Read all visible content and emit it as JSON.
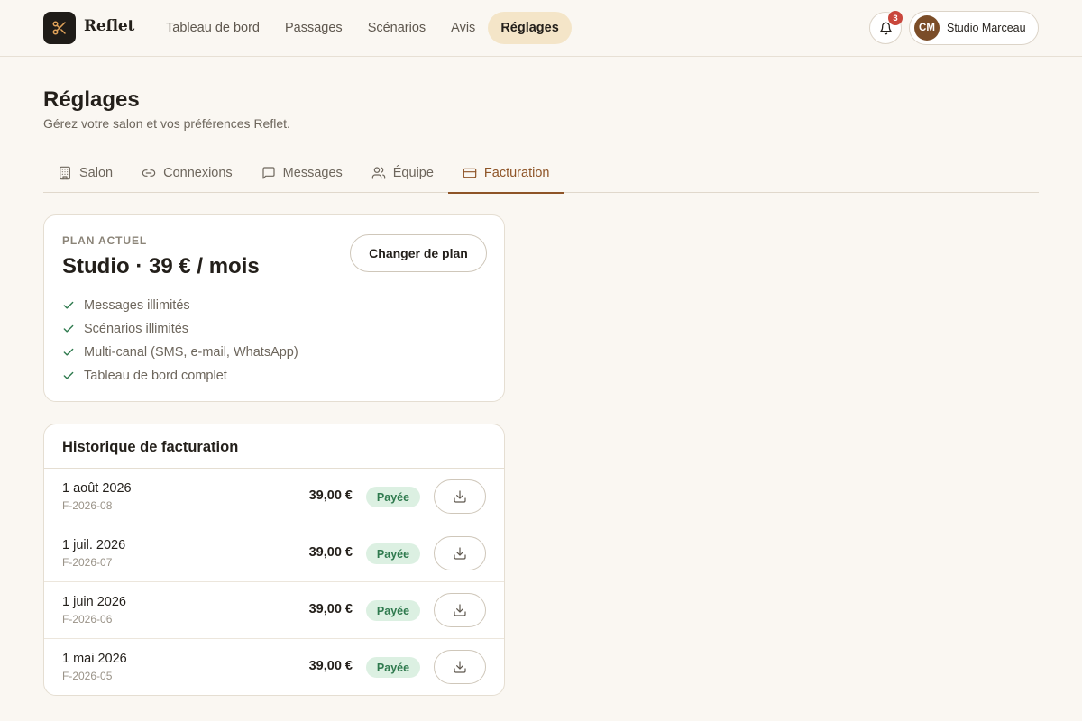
{
  "header": {
    "brand": "Reflet",
    "logo_icon": "scissors-icon",
    "nav": [
      {
        "label": "Tableau de bord"
      },
      {
        "label": "Passages"
      },
      {
        "label": "Scénarios"
      },
      {
        "label": "Avis"
      },
      {
        "label": "Réglages",
        "active": true
      }
    ],
    "notifications_count": "3",
    "account": {
      "initials": "CM",
      "name": "Studio Marceau"
    }
  },
  "page": {
    "title": "Réglages",
    "subtitle": "Gérez votre salon et vos préférences Reflet."
  },
  "tabs": [
    {
      "label": "Salon",
      "icon": "building-icon"
    },
    {
      "label": "Connexions",
      "icon": "link-icon"
    },
    {
      "label": "Messages",
      "icon": "message-icon"
    },
    {
      "label": "Équipe",
      "icon": "team-icon"
    },
    {
      "label": "Facturation",
      "icon": "credit-card-icon",
      "active": true
    }
  ],
  "plan": {
    "label": "PLAN ACTUEL",
    "title": "Studio · 39 € / mois",
    "change_label": "Changer de plan",
    "features": [
      "Messages illimités",
      "Scénarios illimités",
      "Multi-canal (SMS, e-mail, WhatsApp)",
      "Tableau de bord complet"
    ]
  },
  "history": {
    "title": "Historique de facturation",
    "rows": [
      {
        "date": "1 août 2026",
        "ref": "F-2026-08",
        "amount": "39,00 €",
        "status": "Payée"
      },
      {
        "date": "1 juil. 2026",
        "ref": "F-2026-07",
        "amount": "39,00 €",
        "status": "Payée"
      },
      {
        "date": "1 juin 2026",
        "ref": "F-2026-06",
        "amount": "39,00 €",
        "status": "Payée"
      },
      {
        "date": "1 mai 2026",
        "ref": "F-2026-05",
        "amount": "39,00 €",
        "status": "Payée"
      }
    ]
  },
  "colors": {
    "accent": "#8e5427",
    "active_nav_bg": "#f4e5c8",
    "status_paid_bg": "#dcf0e2",
    "status_paid_text": "#2f7a4e",
    "badge": "#c9473c",
    "check": "#2f7a4e"
  }
}
